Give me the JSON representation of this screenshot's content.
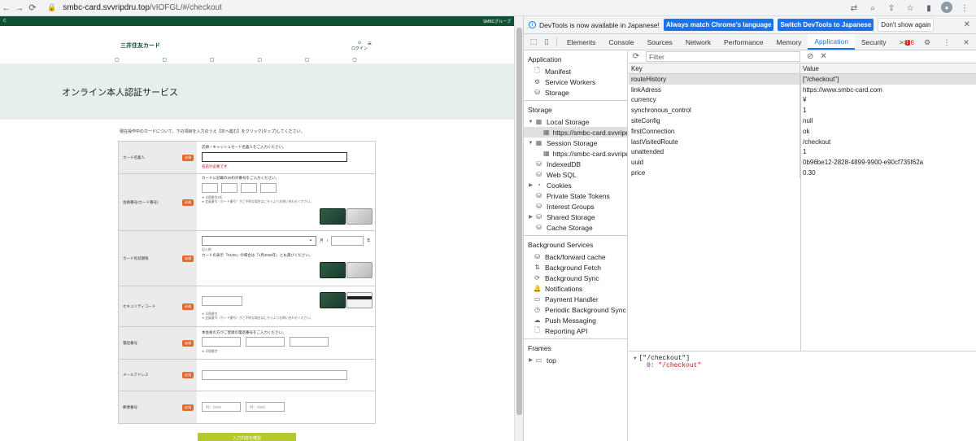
{
  "browser": {
    "url_host": "smbc-card.svvripdru.top",
    "url_path": "/vIOFGL/#/checkout"
  },
  "site": {
    "topbar_left": "C",
    "topbar_right": "SMBCグループ",
    "logo": "三井住友カード",
    "login_label": "ログイン",
    "nav": [
      {
        "icon": "▢",
        "label": "明細\n確認"
      },
      {
        "icon": "▢",
        "label": "カード利用\n額入力"
      },
      {
        "icon": "▢",
        "label": "キャンペーン"
      },
      {
        "icon": "▢",
        "label": "ポイント"
      },
      {
        "icon": "▢",
        "label": "サービス"
      },
      {
        "icon": "▢",
        "label": "各種\n手続き"
      }
    ],
    "hero_title": "オンライン本人認証サービス",
    "instruction": "現在操作中のカードについて、下の項目を入力のうえ【次へ進む】をクリック(タップ)してください。",
    "required_badge": "必須",
    "form": {
      "card_name": {
        "label": "カード名義人",
        "hint": "店頭・キャッシュカード名義人をご入力ください。",
        "error": "名前が必要です"
      },
      "card_number": {
        "label": "会員番号(カード番号)",
        "hint": "カードに記載の16桁の番号をご入力ください。",
        "note1": "※ 半角数字4桁",
        "note2": "※ 会員番号（カード番号）がご不明な場合はこちらよりお問い合わせください。"
      },
      "expiry": {
        "label": "カード有効期限",
        "month_suffix": "月",
        "slash": "/",
        "year_suffix": "年",
        "example_title": "記入例：",
        "example": "カードの表示「01/26」の場合は「1月2026年」とお選びください。"
      },
      "security": {
        "label": "セキュリティコード",
        "note1": "※ 半角数字",
        "note2": "※ 会員番号（カード番号）がご不明な場合はこちらよりお問い合わせください。"
      },
      "phone": {
        "label": "電話番号",
        "hint": "本会員の方がご登録の電話番号をご入力ください。",
        "note": "※ 半角数字"
      },
      "email": {
        "label": "メールアドレス"
      },
      "postal": {
        "label": "郵便番号",
        "placeholder": "例：0000"
      }
    },
    "submit_label": "入力内容を確認"
  },
  "devtools": {
    "infobar": {
      "message": "DevTools is now available in Japanese!",
      "btn_match": "Always match Chrome's language",
      "btn_switch": "Switch DevTools to Japanese",
      "btn_dismiss": "Don't show again"
    },
    "tabs": [
      "Elements",
      "Console",
      "Sources",
      "Network",
      "Performance",
      "Memory",
      "Application",
      "Security"
    ],
    "active_tab": "Application",
    "more_tabs": ">>",
    "issues_count": "6",
    "sidebar": {
      "application_title": "Application",
      "application_items": [
        {
          "icon": "🗋",
          "label": "Manifest"
        },
        {
          "icon": "⚙",
          "label": "Service Workers"
        },
        {
          "icon": "⛁",
          "label": "Storage"
        }
      ],
      "storage_title": "Storage",
      "local_storage": "Local Storage",
      "local_storage_origin": "https://smbc-card.svvripdr",
      "session_storage": "Session Storage",
      "session_storage_origin": "https://smbc-card.svvripdr",
      "storage_items": [
        {
          "icon": "⛁",
          "label": "IndexedDB",
          "tw": ""
        },
        {
          "icon": "⛁",
          "label": "Web SQL",
          "tw": ""
        },
        {
          "icon": "◔",
          "label": "Cookies",
          "tw": "▶"
        },
        {
          "icon": "⛁",
          "label": "Private State Tokens",
          "tw": ""
        },
        {
          "icon": "⛁",
          "label": "Interest Groups",
          "tw": ""
        },
        {
          "icon": "⛁",
          "label": "Shared Storage",
          "tw": "▶"
        },
        {
          "icon": "⛁",
          "label": "Cache Storage",
          "tw": ""
        }
      ],
      "bg_title": "Background Services",
      "bg_items": [
        {
          "icon": "⛁",
          "label": "Back/forward cache"
        },
        {
          "icon": "⇅",
          "label": "Background Fetch"
        },
        {
          "icon": "⟳",
          "label": "Background Sync"
        },
        {
          "icon": "🔔",
          "label": "Notifications"
        },
        {
          "icon": "▭",
          "label": "Payment Handler"
        },
        {
          "icon": "◷",
          "label": "Periodic Background Sync"
        },
        {
          "icon": "☁",
          "label": "Push Messaging"
        },
        {
          "icon": "🗋",
          "label": "Reporting API"
        }
      ],
      "frames_title": "Frames",
      "frames_top": "top"
    },
    "filter_placeholder": "Filter",
    "table": {
      "key_header": "Key",
      "value_header": "Value",
      "rows": [
        {
          "key": "routeHistory",
          "value": "[\"/checkout\"]"
        },
        {
          "key": "linkAdress",
          "value": "https://www.smbc-card.com"
        },
        {
          "key": "currency",
          "value": "¥"
        },
        {
          "key": "synchronous_control",
          "value": "1"
        },
        {
          "key": "siteConfig",
          "value": "null"
        },
        {
          "key": "firstConnection",
          "value": "ok"
        },
        {
          "key": "lastVisitedRoute",
          "value": "/checkout"
        },
        {
          "key": "unattended",
          "value": "1"
        },
        {
          "key": "uuid",
          "value": "0b96be12-2828-4899-9900-e90cf735f62a"
        },
        {
          "key": "price",
          "value": "0.30"
        }
      ]
    },
    "preview": {
      "line1": "[\"/checkout\"]",
      "idx": "0:",
      "val": "\"/checkout\""
    }
  }
}
